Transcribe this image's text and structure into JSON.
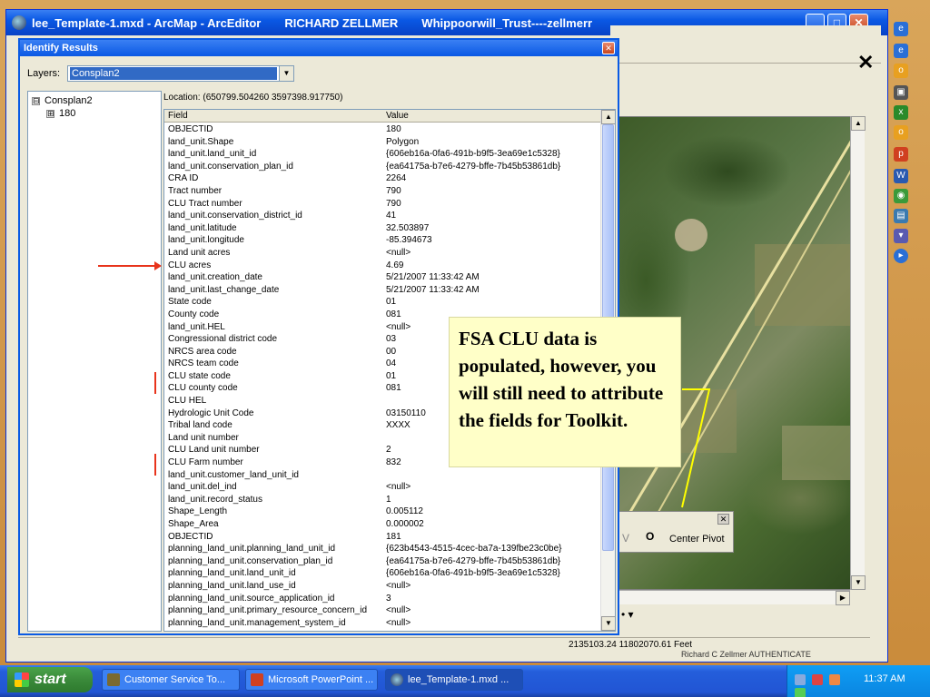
{
  "arcmap_window": {
    "title_doc": "lee_Template-1.mxd - ArcMap - ArcEditor",
    "title_user": "RICHARD ZELLMER",
    "title_db": "Whippoorwill_Trust----zellmerr",
    "minimize_icon": "minimize-icon",
    "maximize_icon": "maximize-icon",
    "close_icon": "close-icon"
  },
  "identify": {
    "title": "Identify Results",
    "layers_label": "Layers:",
    "layers_value": "Consplan2",
    "tree": {
      "root": "Consplan2",
      "child": "180",
      "root_expander": "⊟",
      "child_expander": "⊞"
    },
    "location": "Location: (650799.504260 3597398.917750)",
    "columns": {
      "field": "Field",
      "value": "Value"
    },
    "rows": [
      {
        "field": "OBJECTID",
        "value": "180"
      },
      {
        "field": "land_unit.Shape",
        "value": "Polygon"
      },
      {
        "field": "land_unit.land_unit_id",
        "value": "{606eb16a-0fa6-491b-b9f5-3ea69e1c5328}"
      },
      {
        "field": "land_unit.conservation_plan_id",
        "value": "{ea64175a-b7e6-4279-bffe-7b45b53861db}"
      },
      {
        "field": "CRA ID",
        "value": "2264"
      },
      {
        "field": "Tract number",
        "value": "790"
      },
      {
        "field": "CLU Tract number",
        "value": "790"
      },
      {
        "field": "land_unit.conservation_district_id",
        "value": "41"
      },
      {
        "field": "land_unit.latitude",
        "value": "32.503897"
      },
      {
        "field": "land_unit.longitude",
        "value": "-85.394673"
      },
      {
        "field": "Land unit acres",
        "value": "<null>"
      },
      {
        "field": "CLU acres",
        "value": "4.69"
      },
      {
        "field": "land_unit.creation_date",
        "value": "5/21/2007 11:33:42 AM"
      },
      {
        "field": "land_unit.last_change_date",
        "value": "5/21/2007 11:33:42 AM"
      },
      {
        "field": "State code",
        "value": "01"
      },
      {
        "field": "County code",
        "value": "081"
      },
      {
        "field": "land_unit.HEL",
        "value": "<null>"
      },
      {
        "field": "Congressional district code",
        "value": "03"
      },
      {
        "field": "NRCS area code",
        "value": "00"
      },
      {
        "field": "NRCS team code",
        "value": "04"
      },
      {
        "field": "CLU state code",
        "value": "01"
      },
      {
        "field": "CLU county code",
        "value": "081"
      },
      {
        "field": "CLU HEL",
        "value": ""
      },
      {
        "field": "Hydrologic Unit Code",
        "value": "03150110"
      },
      {
        "field": "Tribal land code",
        "value": "XXXX"
      },
      {
        "field": "Land unit number",
        "value": ""
      },
      {
        "field": "CLU Land unit number",
        "value": "2"
      },
      {
        "field": "CLU Farm number",
        "value": "832"
      },
      {
        "field": "land_unit.customer_land_unit_id",
        "value": ""
      },
      {
        "field": "land_unit.del_ind",
        "value": "<null>"
      },
      {
        "field": "land_unit.record_status",
        "value": "1"
      },
      {
        "field": "Shape_Length",
        "value": "0.005112"
      },
      {
        "field": "Shape_Area",
        "value": "0.000002"
      },
      {
        "field": "OBJECTID",
        "value": "181"
      },
      {
        "field": "planning_land_unit.planning_land_unit_id",
        "value": "{623b4543-4515-4cec-ba7a-139fbe23c0be}"
      },
      {
        "field": "planning_land_unit.conservation_plan_id",
        "value": "{ea64175a-b7e6-4279-bffe-7b45b53861db}"
      },
      {
        "field": "planning_land_unit.land_unit_id",
        "value": "{606eb16a-0fa6-491b-b9f5-3ea69e1c5328}"
      },
      {
        "field": "planning_land_unit.land_use_id",
        "value": "<null>"
      },
      {
        "field": "planning_land_unit.source_application_id",
        "value": "3"
      },
      {
        "field": "planning_land_unit.primary_resource_concern_id",
        "value": "<null>"
      },
      {
        "field": "planning_land_unit.management_system_id",
        "value": "<null>"
      }
    ]
  },
  "callout": {
    "text": "FSA CLU data is populated, however, you will still need to attribute the fields for Toolkit."
  },
  "pivot_toolbar": {
    "v_label": "V",
    "o_label": "O",
    "center_pivot_label": "Center Pivot"
  },
  "draw_toolbar": {
    "label": "• ▾"
  },
  "status": {
    "coords": "2135103.24  11802070.61 Feet",
    "extra": "Richard C Zellmer     AUTHENTICATE"
  },
  "taskbar": {
    "start_label": "start",
    "tasks": [
      {
        "label": "Customer Service To..."
      },
      {
        "label": "Microsoft PowerPoint ..."
      },
      {
        "label": "lee_Template-1.mxd ..."
      }
    ],
    "clock": "11:37 AM"
  },
  "colors": {
    "xp_blue": "#0a58e4",
    "callout_bg": "#ffffc8",
    "marker_red": "#e8341c",
    "start_green": "#3a8a3a"
  }
}
